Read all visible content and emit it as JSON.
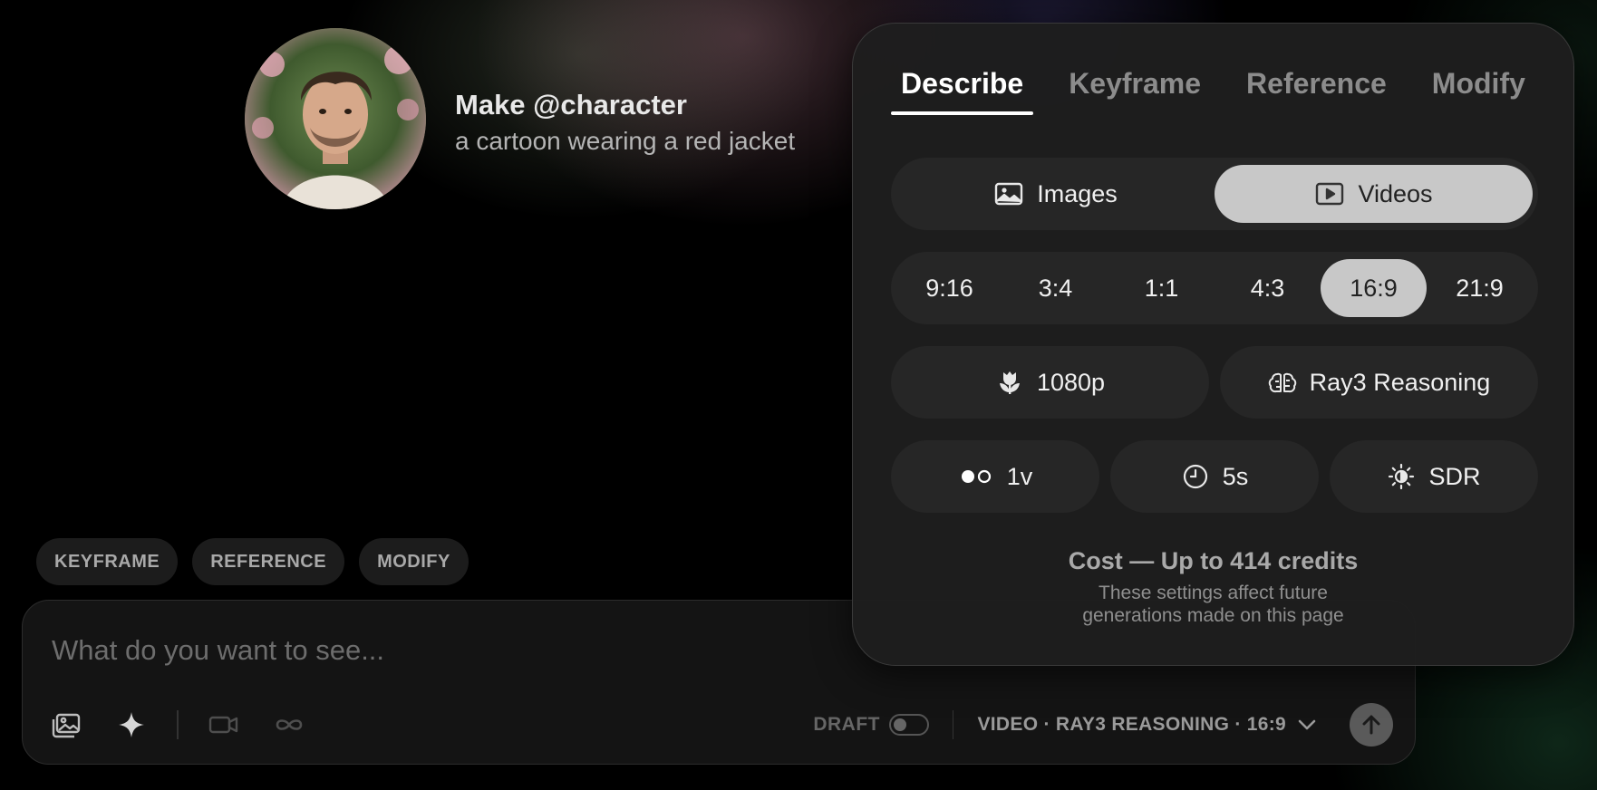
{
  "prompt_preview": {
    "title": "Make @character",
    "subtitle": "a cartoon wearing a red jacket"
  },
  "chips": [
    {
      "label": "KEYFRAME"
    },
    {
      "label": "REFERENCE"
    },
    {
      "label": "MODIFY"
    }
  ],
  "composer": {
    "placeholder": "What do you want to see...",
    "value": "",
    "toolbar_icons": [
      "add-images-icon",
      "sparkle-icon",
      "video-camera-icon",
      "infinity-icon"
    ],
    "draft_label": "DRAFT",
    "draft_enabled": false,
    "model_label": "VIDEO · RAY3 REASONING · 16:9",
    "send_icon": "arrow-up-icon"
  },
  "panel": {
    "tabs": [
      {
        "label": "Describe",
        "active": true
      },
      {
        "label": "Keyframe",
        "active": false
      },
      {
        "label": "Reference",
        "active": false
      },
      {
        "label": "Modify",
        "active": false
      }
    ],
    "media_types": [
      {
        "label": "Images",
        "icon": "image-icon",
        "active": false
      },
      {
        "label": "Videos",
        "icon": "play-icon",
        "active": true
      }
    ],
    "aspect_ratios": [
      {
        "label": "9:16",
        "active": false
      },
      {
        "label": "3:4",
        "active": false
      },
      {
        "label": "1:1",
        "active": false
      },
      {
        "label": "4:3",
        "active": false
      },
      {
        "label": "16:9",
        "active": true
      },
      {
        "label": "21:9",
        "active": false
      }
    ],
    "resolution": {
      "label": "1080p",
      "icon": "tulip-icon"
    },
    "model": {
      "label": "Ray3 Reasoning",
      "icon": "brain-icon"
    },
    "variations": {
      "label": "1v",
      "icon": "variations-dots-icon"
    },
    "duration": {
      "label": "5s",
      "icon": "clock-icon"
    },
    "dynamic_range": {
      "label": "SDR",
      "icon": "brightness-icon"
    },
    "cost_title": "Cost — Up to 414 credits",
    "cost_note_line1": "These settings affect future",
    "cost_note_line2": "generations made on this page"
  },
  "colors": {
    "panel_bg": "#1e1e1e",
    "active_segment": "#c8c8c8",
    "pill_bg": "#262626"
  }
}
